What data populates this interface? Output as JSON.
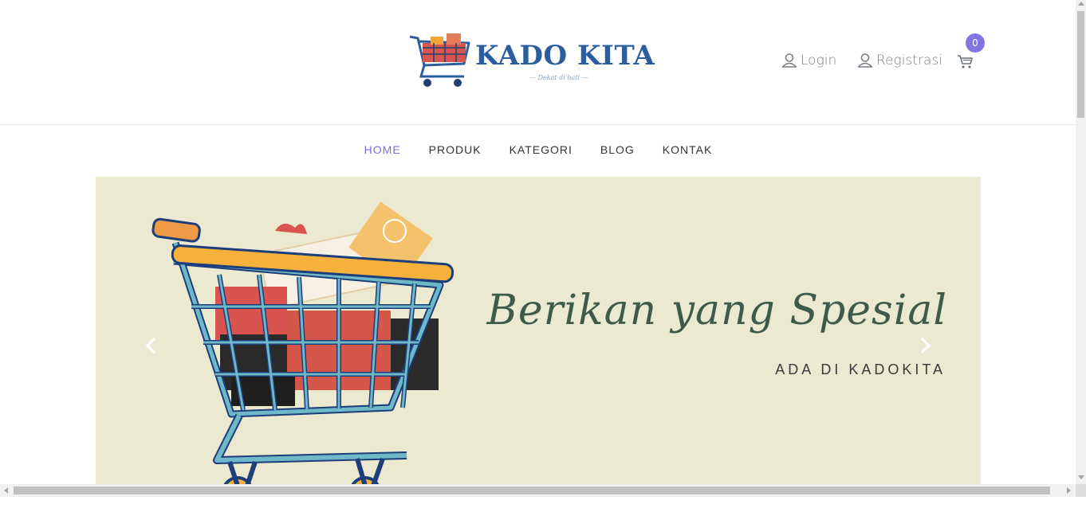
{
  "brand": {
    "name": "KADO KITA",
    "tagline": "--- Dekat di hati ---"
  },
  "header": {
    "login_label": "Login",
    "register_label": "Registrasi",
    "cart_count": "0",
    "icons": {
      "user": "user-icon",
      "cart": "cart-icon"
    }
  },
  "nav": {
    "items": [
      {
        "label": "HOME",
        "active": true
      },
      {
        "label": "PRODUK",
        "active": false
      },
      {
        "label": "KATEGORI",
        "active": false
      },
      {
        "label": "BLOG",
        "active": false
      },
      {
        "label": "KONTAK",
        "active": false
      }
    ]
  },
  "hero": {
    "title": "Berikan yang Spesial",
    "subtitle": "ADA DI KADOKITA",
    "background": "#ebe9d0"
  },
  "colors": {
    "accent": "#7b6fd3",
    "badge": "#8275e3",
    "brand_blue": "#2c5e9e",
    "hero_text": "#3f5a48"
  }
}
